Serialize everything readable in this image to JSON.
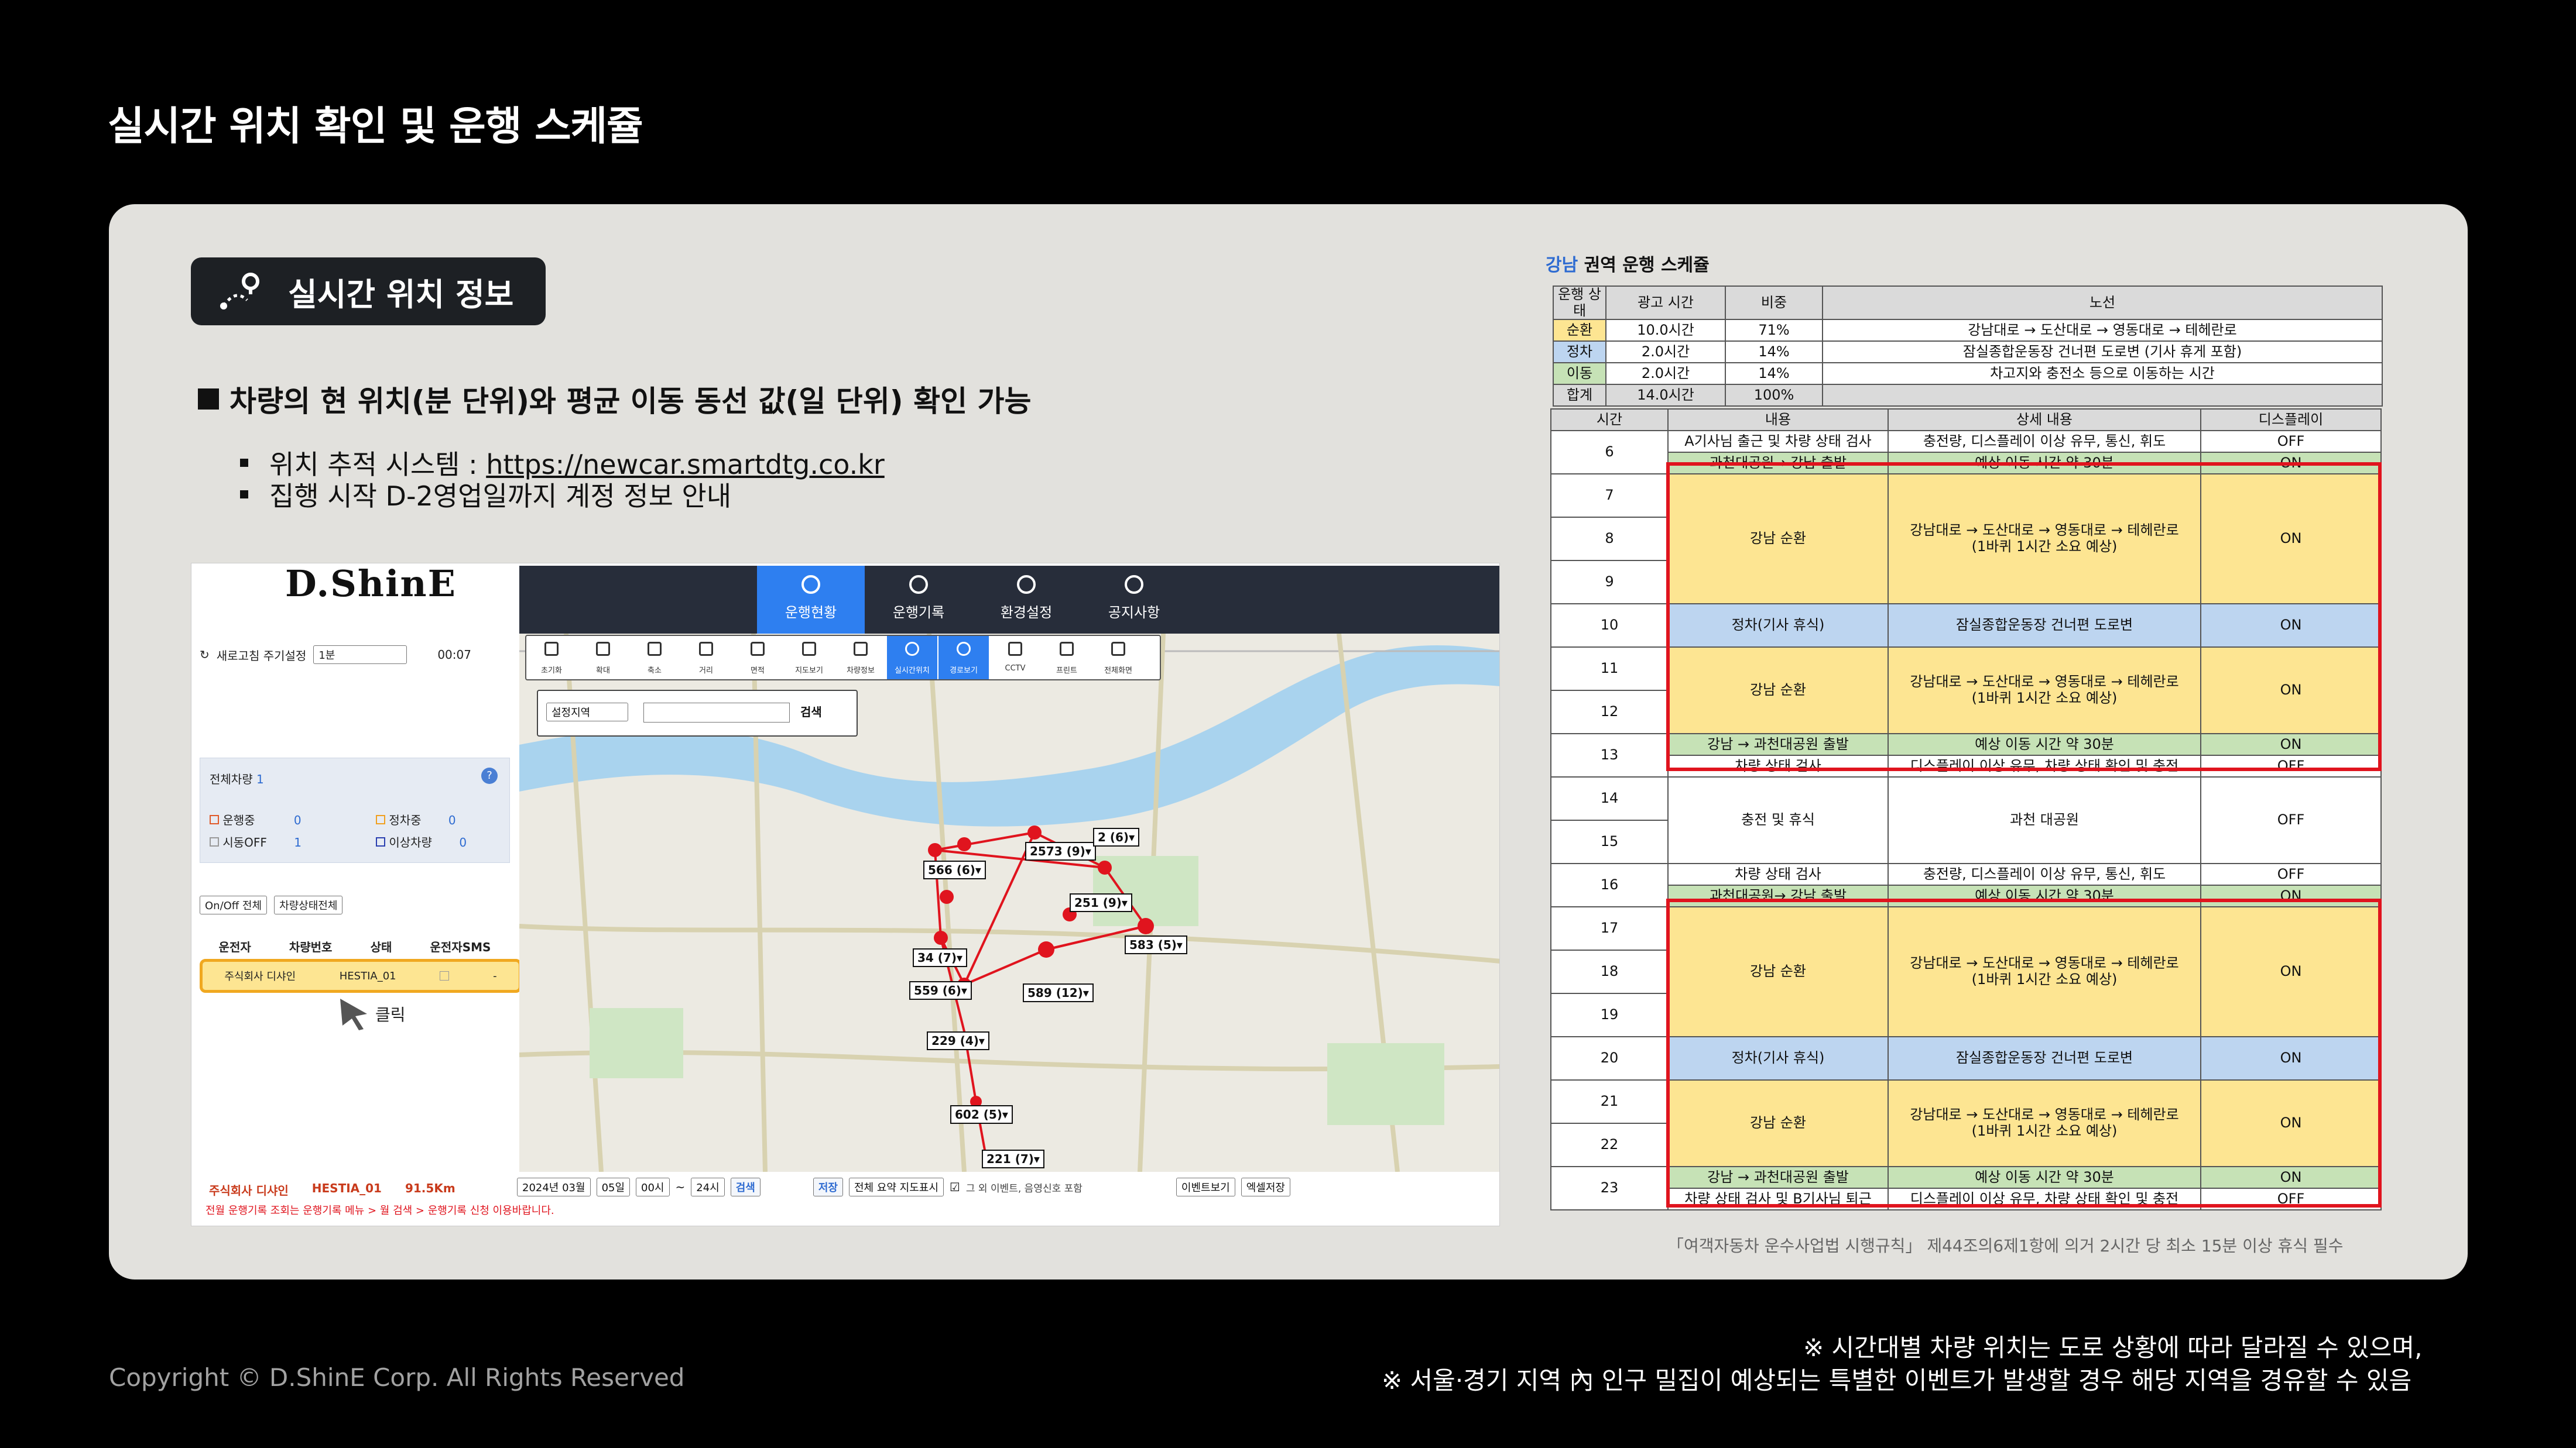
{
  "slide": {
    "title": "실시간 위치 확인 및 운행 스케쥴",
    "badge_label": "실시간 위치 정보",
    "headline": "차량의 현 위치(분 단위)와 평균 이동 동선 값(일 단위) 확인 가능",
    "bullets": [
      {
        "prefix": "위치 추적 시스템 : ",
        "link": "https://newcar.smartdtg.co.kr"
      },
      {
        "prefix": "집행 시작 D-2영업일까지 계정 정보 안내",
        "link": ""
      }
    ],
    "notes": [
      "※ 시간대별 차량 위치는 도로 상황에 따라 달라질 수 있으며,",
      "※ 서울·경기 지역 內 인구 밀집이 예상되는 특별한 이벤트가 발생할 경우 해당 지역을 경유할 수 있음"
    ],
    "copyright": "Copyright © D.ShinE Corp. All Rights Reserved"
  },
  "app": {
    "logo": "D.ShinE",
    "nav_tabs": [
      {
        "label": "운행현황",
        "active": true,
        "icon": "dashboard-icon"
      },
      {
        "label": "운행기록",
        "active": false,
        "icon": "gauge-icon"
      },
      {
        "label": "환경설정",
        "active": false,
        "icon": "gear-icon"
      },
      {
        "label": "공지사항",
        "active": false,
        "icon": "bell-icon"
      }
    ],
    "sidebar": {
      "refresh_label": "새로고침 주기설정",
      "refresh_value": "1분",
      "timer": "00:07",
      "total_label": "전체차량",
      "total_count": "1",
      "status": [
        {
          "label": "운행중",
          "count": "0",
          "color": "#e05a2a"
        },
        {
          "label": "정차중",
          "count": "0",
          "color": "#f0a020"
        },
        {
          "label": "시동OFF",
          "count": "1",
          "color": "#999999"
        },
        {
          "label": "이상차량",
          "count": "0",
          "color": "#2a3fb0"
        }
      ],
      "filter1": "On/Off 전체",
      "filter2": "차량상태전체",
      "table_headers": [
        "운전자",
        "차량번호",
        "상태",
        "운전자SMS"
      ],
      "row": {
        "driver": "주식회사 디샤인",
        "plate": "HESTIA_01",
        "status": "",
        "sms": "-"
      },
      "click_label": "클릭"
    },
    "toolbar": [
      "초기화",
      "확대",
      "축소",
      "거리",
      "면적",
      "지도보기",
      "차량정보",
      "실시간위치",
      "경로보기",
      "CCTV",
      "프린트",
      "전체화면"
    ],
    "map_search": {
      "select": "설정지역",
      "button": "검색"
    },
    "vehicle_labels": [
      "2573 (9)▾",
      "566 (6)▾",
      "251 (9)▾",
      "583 (5)▾",
      "559 (6)▾",
      "589 (12)▾",
      "229 (4)▾",
      "602 (5)▾",
      "221 (7)▾",
      "34 (7)▾",
      "2 (6)▾"
    ],
    "bottom": {
      "driver": "주식회사 디샤인",
      "plate": "HESTIA_01",
      "distance": "91.5Km",
      "year_month": "2024년 03월",
      "day": "05일",
      "from": "00시",
      "to": "24시",
      "search": "검색",
      "save": "저장",
      "summary_select": "전체 요약 지도표시",
      "checkbox_label": "그 외 이벤트, 음영신호 포함",
      "event_btn": "이벤트보기",
      "excel_btn": "엑셀저장",
      "warning": "전월 운행기록 조회는 운행기록 메뉴 > 월 검색 > 운행기록 신청 이용바랍니다."
    }
  },
  "schedule": {
    "title_area": "강남",
    "title_rest": "권역 운행 스케쥴",
    "summary_headers": [
      "운행 상태",
      "광고 시간",
      "비중",
      "노선"
    ],
    "summary_rows": [
      {
        "state": "순환",
        "time": "10.0시간",
        "ratio": "71%",
        "route": "강남대로 → 도산대로 → 영동대로 → 테헤란로",
        "color": "#fde592"
      },
      {
        "state": "정차",
        "time": "2.0시간",
        "ratio": "14%",
        "route": "잠실종합운동장 건너편 도로변 (기사 휴게 포함)",
        "color": "#bdd5f0"
      },
      {
        "state": "이동",
        "time": "2.0시간",
        "ratio": "14%",
        "route": "차고지와 충전소 등으로 이동하는 시간",
        "color": "#c6e2b6"
      },
      {
        "state": "합계",
        "time": "14.0시간",
        "ratio": "100%",
        "route": "",
        "color": "#dadada"
      }
    ],
    "detail_headers": [
      "시간",
      "내용",
      "상세 내용",
      "디스플레이"
    ],
    "hours": [
      "6",
      "7",
      "8",
      "9",
      "10",
      "11",
      "12",
      "13",
      "14",
      "15",
      "16",
      "17",
      "18",
      "19",
      "20",
      "21",
      "22",
      "23"
    ],
    "cells": {
      "a_content": "A기사님 출근 및 차량 상태 검사",
      "a_detail": "충전량, 디스플레이 이상 유무, 통신, 휘도",
      "go_content": "과천대공원→ 강남 출발",
      "go_detail": "예상 이동 시간 약 30분",
      "loop_content": "강남 순환",
      "loop_detail": "강남대로 → 도산대로 → 영동대로 → 테헤란로\n(1바퀴 1시간 소요 예상)",
      "rest_content": "정차(기사 휴식)",
      "rest_detail": "잠실종합운동장 건너편 도로변",
      "back_content": "강남 → 과천대공원 출발",
      "back_detail": "예상 이동 시간 약 30분",
      "check_content": "차량 상태 검사",
      "check_detail": "디스플레이 이상 유무, 차량 상태 확인 및 충전",
      "charge_content": "충전 및 휴식",
      "charge_detail": "과천 대공원",
      "check2_content": "차량 상태 검사",
      "check2_detail": "충전량, 디스플레이 이상 유무, 통신, 휘도",
      "go2_content": "과천대공원→ 강남 출발",
      "end_content": "차량 상태 검사 및 B기사님 퇴근",
      "end_detail": "디스플레이 이상 유무, 차량 상태 확인 및 충전",
      "on": "ON",
      "off": "OFF"
    },
    "law_note": "「여객자동차 운수사업법 시행규칙」 제44조의6제1항에 의거 2시간 당 최소 15분 이상 휴식 필수"
  }
}
